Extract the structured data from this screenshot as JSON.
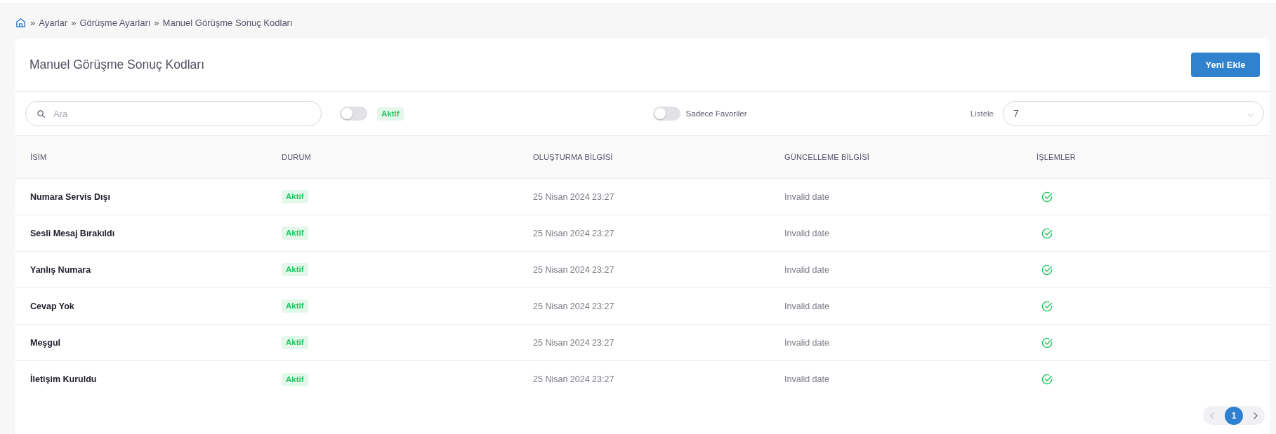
{
  "breadcrumb": {
    "items": [
      {
        "separator": "»",
        "label": "Ayarlar"
      },
      {
        "separator": "»",
        "label": "Görüşme Ayarları"
      },
      {
        "separator": "»",
        "label": "Manuel Görüşme Sonuç Kodları"
      }
    ]
  },
  "header": {
    "title": "Manuel Görüşme Sonuç Kodları",
    "add_button": "Yeni Ekle"
  },
  "toolbar": {
    "search": {
      "placeholder": "Ara"
    },
    "status_filter": {
      "on": false,
      "badge": "Aktif"
    },
    "favorites_filter": {
      "on": false,
      "label": "Sadece Favoriler"
    },
    "page_size": {
      "label": "Listele",
      "value": "7"
    }
  },
  "table": {
    "columns": [
      "İSİM",
      "DURUM",
      "OLUŞTURMA BİLGİSİ",
      "GÜNCELLEME BİLGİSİ",
      "İŞLEMLER"
    ],
    "rows": [
      {
        "name": "Numara Servis Dışı",
        "status": "Aktif",
        "created": "25 Nisan 2024 23:27",
        "updated": "Invalid date"
      },
      {
        "name": "Sesli Mesaj Bırakıldı",
        "status": "Aktif",
        "created": "25 Nisan 2024 23:27",
        "updated": "Invalid date"
      },
      {
        "name": "Yanlış Numara",
        "status": "Aktif",
        "created": "25 Nisan 2024 23:27",
        "updated": "Invalid date"
      },
      {
        "name": "Cevap Yok",
        "status": "Aktif",
        "created": "25 Nisan 2024 23:27",
        "updated": "Invalid date"
      },
      {
        "name": "Meşgul",
        "status": "Aktif",
        "created": "25 Nisan 2024 23:27",
        "updated": "Invalid date"
      },
      {
        "name": "İletişim Kuruldu",
        "status": "Aktif",
        "created": "25 Nisan 2024 23:27",
        "updated": "Invalid date"
      }
    ]
  },
  "pagination": {
    "prev": {
      "disabled": true
    },
    "pages": [
      {
        "label": "1",
        "selected": true
      }
    ],
    "next": {
      "disabled": false
    }
  }
}
